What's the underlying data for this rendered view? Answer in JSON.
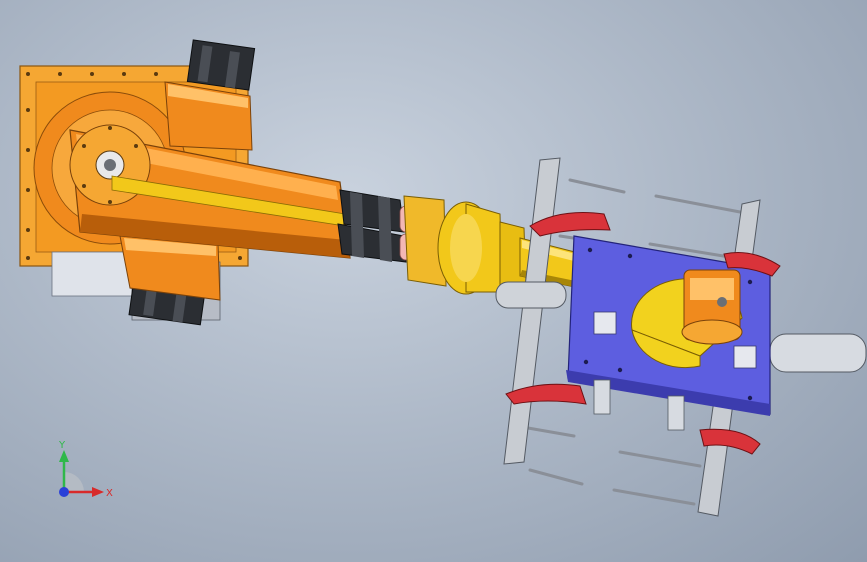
{
  "viewport": {
    "background_top": "#c9d2de",
    "background_bottom": "#8f9cae"
  },
  "model": {
    "colors": {
      "base_plate": "#f5a733",
      "arm_orange": "#f08a1d",
      "arm_highlight": "#ffc168",
      "arm_shadow": "#b85e0a",
      "forearm_yellow": "#f2c81a",
      "forearm_shadow": "#a88607",
      "motor_dark": "#2b2e33",
      "gripper_frame": "#5d5ee0",
      "gripper_frame_dark": "#3c3cae",
      "finger_red": "#d9333a",
      "rail_silver": "#c8ccd2",
      "rod_gray": "#8a8f98"
    }
  },
  "triad": {
    "y_label": "Y",
    "x_label": "X",
    "icon": "coordinate-triad-icon",
    "y_color": "#2fb84a",
    "x_color": "#d82a2a",
    "z_color": "#2a40d8"
  }
}
